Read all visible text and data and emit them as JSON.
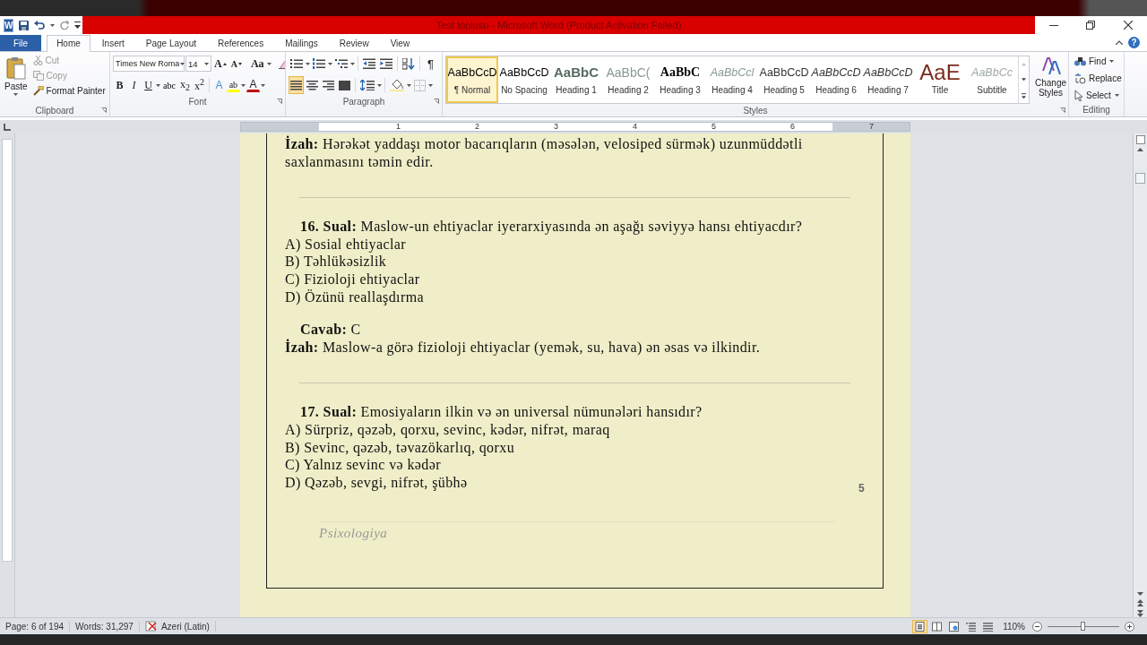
{
  "app_icon": "W",
  "window": {
    "title": "Test toplusu - Microsoft Word (Product Activation Failed)"
  },
  "tabs": [
    {
      "label": "File",
      "kind": "file",
      "selected": false
    },
    {
      "label": "Home",
      "kind": "tab",
      "selected": true
    },
    {
      "label": "Insert",
      "kind": "tab",
      "selected": false
    },
    {
      "label": "Page Layout",
      "kind": "tab",
      "selected": false
    },
    {
      "label": "References",
      "kind": "tab",
      "selected": false
    },
    {
      "label": "Mailings",
      "kind": "tab",
      "selected": false
    },
    {
      "label": "Review",
      "kind": "tab",
      "selected": false
    },
    {
      "label": "View",
      "kind": "tab",
      "selected": false
    }
  ],
  "help": "?",
  "ribbon": {
    "clipboard": {
      "label": "Clipboard",
      "paste": "Paste",
      "items": [
        {
          "label": "Cut",
          "kind": "cut",
          "disabled": true
        },
        {
          "label": "Copy",
          "kind": "copy",
          "disabled": true
        },
        {
          "label": "Format Painter",
          "kind": "painter",
          "disabled": false
        }
      ]
    },
    "font": {
      "label": "Font",
      "name": "Times New Roma",
      "size": "14",
      "row1": [
        {
          "kind": "grow",
          "label": "A"
        },
        {
          "kind": "shrink",
          "label": "A"
        },
        {
          "kind": "case",
          "label": "Aa"
        },
        {
          "kind": "clear"
        }
      ],
      "row2": [
        {
          "kind": "bold",
          "label": "B"
        },
        {
          "kind": "italic",
          "label": "I"
        },
        {
          "kind": "underline",
          "label": "U"
        },
        {
          "kind": "strike",
          "label": "abc"
        },
        {
          "kind": "sub",
          "label": "x$_{2}$"
        },
        {
          "kind": "sup",
          "label": "x$^{2}$"
        },
        {
          "kind": "effects",
          "label": "A"
        },
        {
          "kind": "highlight",
          "label": "ab"
        },
        {
          "kind": "color",
          "label": "A"
        }
      ]
    },
    "paragraph": {
      "label": "Paragraph",
      "row1": [
        {
          "kind": "bullets"
        },
        {
          "kind": "numbering"
        },
        {
          "kind": "multilevel"
        },
        {
          "kind": "outdent"
        },
        {
          "kind": "indent"
        },
        {
          "kind": "sort"
        },
        {
          "kind": "pilcrow",
          "label": "¶"
        }
      ],
      "row2": [
        {
          "kind": "align-left",
          "selected": true
        },
        {
          "kind": "align-center",
          "selected": false
        },
        {
          "kind": "align-right",
          "selected": false
        },
        {
          "kind": "justify",
          "selected": false
        },
        {
          "kind": "spacing"
        },
        {
          "kind": "shading"
        },
        {
          "kind": "borders"
        }
      ]
    },
    "styles": {
      "label": "Styles",
      "change": "Change Styles",
      "items": [
        {
          "preview": "AaBbCcD",
          "name": "¶ Normal",
          "kind": "normal",
          "selected": true
        },
        {
          "preview": "AaBbCcD",
          "name": "No Spacing",
          "kind": "normal",
          "selected": false
        },
        {
          "preview": "AaBbC",
          "name": "Heading 1",
          "kind": "heading1",
          "selected": false
        },
        {
          "preview": "AaBbC(",
          "name": "Heading 2",
          "kind": "heading2",
          "selected": false
        },
        {
          "preview": "AaBbC",
          "name": "Heading 3",
          "kind": "heading3",
          "selected": false
        },
        {
          "preview": "AaBbCcl",
          "name": "Heading 4",
          "kind": "heading4",
          "selected": false
        },
        {
          "preview": "AaBbCcD",
          "name": "Heading 5",
          "kind": "heading5",
          "selected": false
        },
        {
          "preview": "AaBbCcD",
          "name": "Heading 6",
          "kind": "heading6",
          "selected": false
        },
        {
          "preview": "AaBbCcD",
          "name": "Heading 7",
          "kind": "heading6",
          "selected": false
        },
        {
          "preview": "AaE",
          "name": "Title",
          "kind": "title",
          "selected": false
        },
        {
          "preview": "AaBbCc",
          "name": "Subtitle",
          "kind": "subtitle",
          "selected": false
        }
      ]
    },
    "editing": {
      "label": "Editing",
      "items": [
        {
          "label": "Find",
          "kind": "find"
        },
        {
          "label": "Replace",
          "kind": "replace"
        },
        {
          "label": "Select",
          "kind": "select"
        }
      ]
    }
  },
  "ruler": [
    "1",
    "2",
    "3",
    "4",
    "5",
    "6",
    "7"
  ],
  "document": {
    "blocks": [
      {
        "kind": "explanation",
        "text": "**İzah:** Hərəkət yaddaşı motor bacarıqların (məsələn, velosiped sürmək) uzunmüddətli saxlanmasını təmin edir."
      },
      {
        "kind": "rule"
      },
      {
        "kind": "question",
        "text": "**16. Sual:** Maslow-un ehtiyaclar iyerarxiyasında ən aşağı səviyyə hansı ehtiyacdır?"
      },
      {
        "kind": "option",
        "text": "A) Sosial ehtiyaclar"
      },
      {
        "kind": "option",
        "text": "B) Təhlükəsizlik"
      },
      {
        "kind": "option",
        "text": "C) Fizioloji ehtiyaclar"
      },
      {
        "kind": "option",
        "text": "D) Özünü reallaşdırma"
      },
      {
        "kind": "answer",
        "text": "**Cavab:** C"
      },
      {
        "kind": "explanation",
        "text": "**İzah:** Maslow-a görə fizioloji ehtiyaclar (yemək, su, hava) ən əsas və ilkindir."
      },
      {
        "kind": "rule"
      },
      {
        "kind": "question",
        "text": "**17. Sual:** Emosiyaların ilkin və ən universal nümunələri hansıdır?"
      },
      {
        "kind": "option",
        "text": "A) Sürpriz, qəzəb, qorxu, sevinc, kədər, nifrət, maraq"
      },
      {
        "kind": "option",
        "text": "B) Sevinc, qəzəb, təvazökarlıq, qorxu"
      },
      {
        "kind": "option",
        "text": "C) Yalnız sevinc və kədər"
      },
      {
        "kind": "option",
        "text": "D) Qəzəb, sevgi, nifrət, şübhə"
      }
    ],
    "page_number": "5",
    "footer": "Psixologiya"
  },
  "status_bar": {
    "page": "Page: 6 of 194",
    "words": "Words: 31,297",
    "language": "Azeri (Latin)",
    "views": [
      {
        "kind": "print",
        "selected": true
      },
      {
        "kind": "reading",
        "selected": false
      },
      {
        "kind": "web",
        "selected": false
      },
      {
        "kind": "outline",
        "selected": false
      },
      {
        "kind": "draft",
        "selected": false
      }
    ],
    "zoom": "110%",
    "zoom_slider": {
      "level": 0.5
    }
  }
}
